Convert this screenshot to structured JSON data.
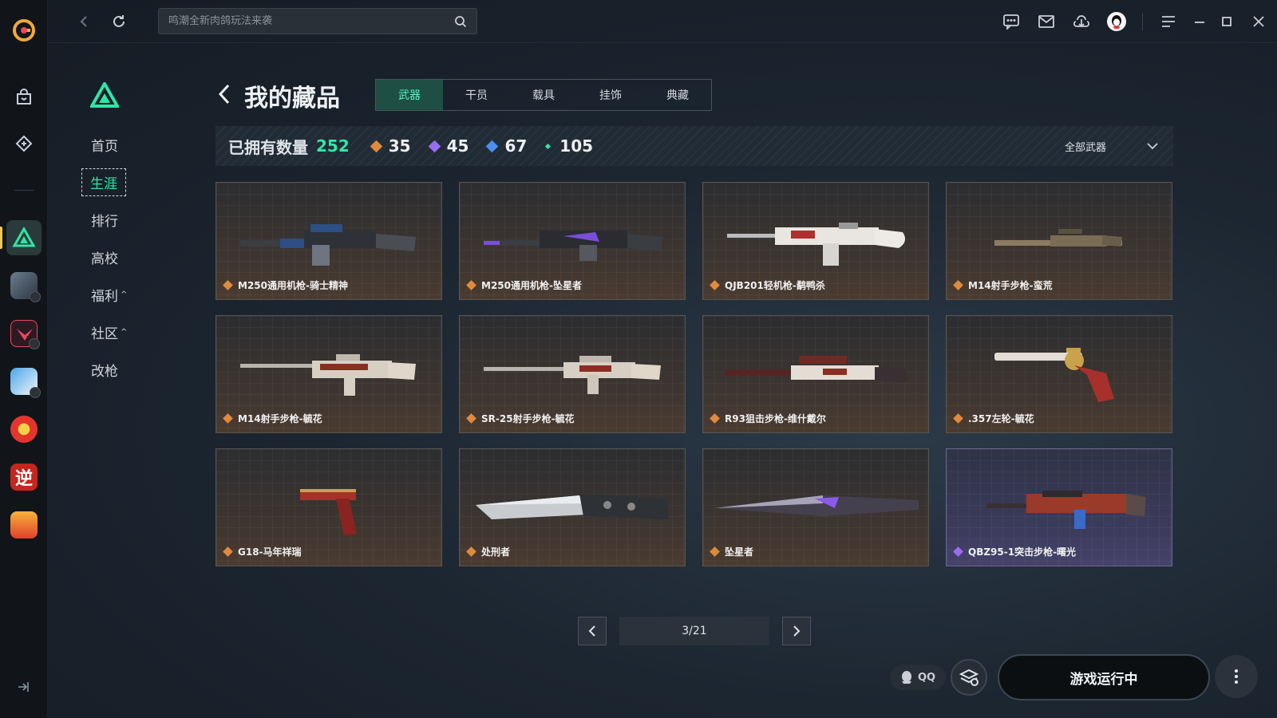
{
  "search": {
    "placeholder": "鸣潮全新肉鸽玩法来袭"
  },
  "sidebar": {
    "items": [
      {
        "label": "首页"
      },
      {
        "label": "生涯"
      },
      {
        "label": "排行"
      },
      {
        "label": "高校"
      },
      {
        "label": "福利",
        "caret": "^"
      },
      {
        "label": "社区",
        "caret": "^"
      },
      {
        "label": "改枪"
      }
    ]
  },
  "header": {
    "title": "我的藏品",
    "tabs": [
      {
        "label": "武器"
      },
      {
        "label": "干员"
      },
      {
        "label": "载具"
      },
      {
        "label": "挂饰"
      },
      {
        "label": "典藏"
      }
    ]
  },
  "stats": {
    "label": "已拥有数量",
    "total": "252",
    "counts": [
      {
        "value": "35",
        "color": "#e08a3c"
      },
      {
        "value": "45",
        "color": "#9a6cf0"
      },
      {
        "value": "67",
        "color": "#4a8ff0"
      },
      {
        "value": "105",
        "color": "#2ee6a6"
      }
    ],
    "filter": "全部武器"
  },
  "items": [
    {
      "name": "M250通用机枪-骑士精神",
      "rarity_color": "#e08a3c"
    },
    {
      "name": "M250通用机枪-坠星者",
      "rarity_color": "#e08a3c"
    },
    {
      "name": "QJB201轻机枪-鹬鸭杀",
      "rarity_color": "#e08a3c"
    },
    {
      "name": "M14射手步枪-蛮荒",
      "rarity_color": "#e08a3c"
    },
    {
      "name": "M14射手步枪-毓花",
      "rarity_color": "#e08a3c"
    },
    {
      "name": "SR-25射手步枪-毓花",
      "rarity_color": "#e08a3c"
    },
    {
      "name": "R93狙击步枪-维什戴尔",
      "rarity_color": "#e08a3c"
    },
    {
      "name": ".357左轮-毓花",
      "rarity_color": "#e08a3c"
    },
    {
      "name": "G18-马年祥瑞",
      "rarity_color": "#e08a3c"
    },
    {
      "name": "处刑者",
      "rarity_color": "#e08a3c"
    },
    {
      "name": "坠星者",
      "rarity_color": "#e08a3c"
    },
    {
      "name": "QBZ95-1突击步枪-曙光",
      "rarity_color": "#9a6cf0"
    }
  ],
  "pagination": {
    "current": "3/21"
  },
  "footer": {
    "qq_label": "QQ",
    "play_label": "游戏运行中"
  },
  "colors": {
    "accent": "#2ee6a6",
    "gold": "#e08a3c",
    "purple": "#9a6cf0"
  }
}
